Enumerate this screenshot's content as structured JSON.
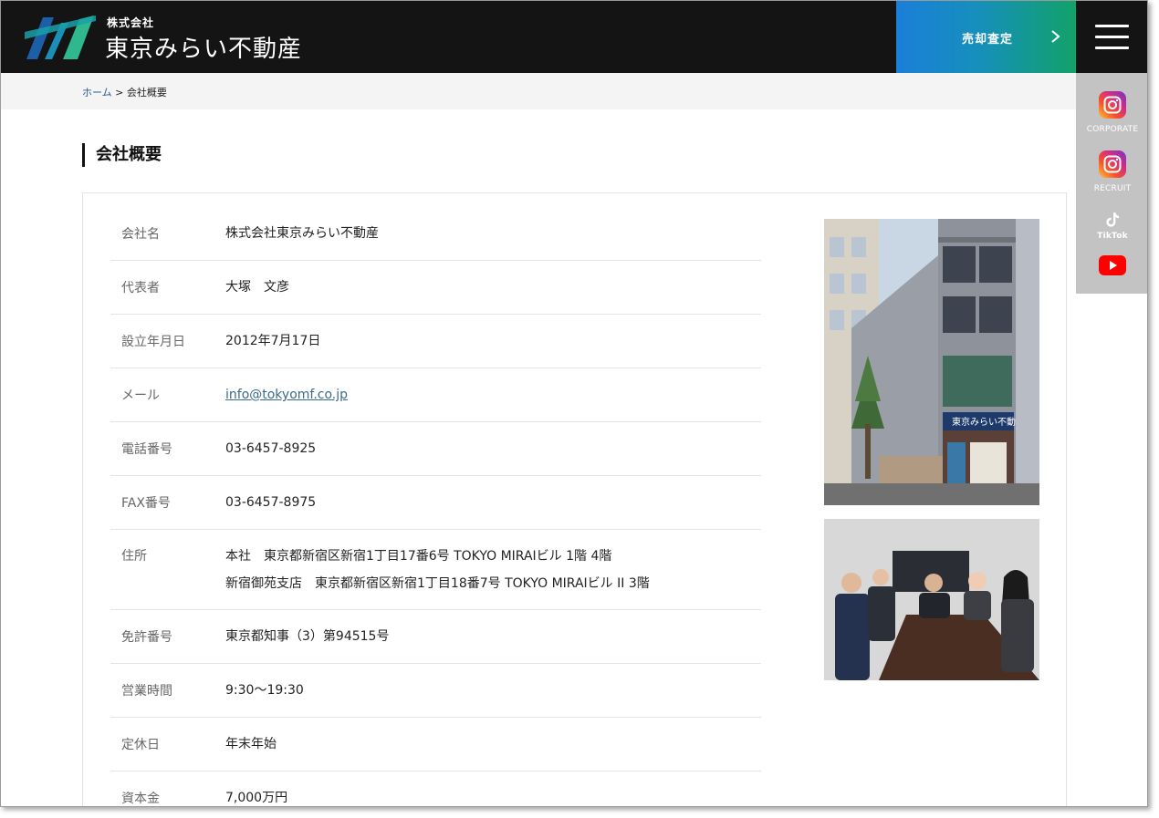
{
  "header": {
    "brand_sub": "株式会社",
    "brand_main": "東京みらい不動産",
    "cta_label": "売却査定"
  },
  "social": {
    "corporate_label": "CORPORATE",
    "recruit_label": "RECRUIT",
    "tiktok_label": "TikTok"
  },
  "breadcrumb": {
    "home": "ホーム",
    "separator": " > ",
    "current": "会社概要"
  },
  "page_title": "会社概要",
  "company": {
    "rows": [
      {
        "label": "会社名",
        "value": "株式会社東京みらい不動産"
      },
      {
        "label": "代表者",
        "value": "大塚　文彦"
      },
      {
        "label": "設立年月日",
        "value": "2012年7月17日"
      },
      {
        "label": "メール",
        "value": "info@tokyomf.co.jp"
      },
      {
        "label": "電話番号",
        "value": "03-6457-8925"
      },
      {
        "label": "FAX番号",
        "value": "03-6457-8975"
      },
      {
        "label": "住所",
        "value": "本社　東京都新宿区新宿1丁目17番6号 TOKYO MIRAIビル 1階 4階",
        "value2": "新宿御苑支店　東京都新宿区新宿1丁目18番7号 TOKYO MIRAIビル II 3階"
      },
      {
        "label": "免許番号",
        "value": "東京都知事（3）第94515号"
      },
      {
        "label": "営業時間",
        "value": "9:30〜19:30"
      },
      {
        "label": "定休日",
        "value": "年末年始"
      },
      {
        "label": "資本金",
        "value": "7,000万円"
      }
    ]
  },
  "photos": {
    "building_sign": "東京みらい不動産"
  },
  "colors": {
    "header_bg": "#141414",
    "cta_gradient_start": "#1a7fd8",
    "cta_gradient_end": "#12a26a",
    "link": "#3a6a8c",
    "social_bar": "#c3c3c3"
  }
}
